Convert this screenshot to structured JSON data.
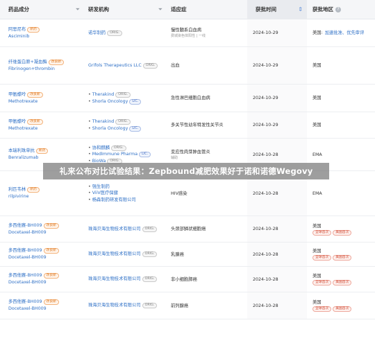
{
  "header": {
    "drug": "药品成分",
    "org": "研发机构",
    "indication": "适应症",
    "approval_date": "获批时间",
    "region": "获批地区",
    "region_help": "?"
  },
  "rows": [
    {
      "drug_cn": "阿思尼布",
      "drug_tag": "新药",
      "drug_tag_style": "t-o",
      "drug_en": "Asciminib",
      "orgs": [
        {
          "name": "诺华制药",
          "tag": "ORIG.",
          "tag_style": "t-g"
        }
      ],
      "indication": "慢性髓系白血病",
      "indication_sub": "费城染色体阳性 | 一线",
      "date": "2024-10-29",
      "region": "美国:",
      "region_extra": "加速批准、优先审评"
    },
    {
      "drug_cn": "纤维蛋白原+凝血酶",
      "drug_tag": "改良新",
      "drug_tag_style": "t-o",
      "drug_en": "Fibrinogen+thrombin",
      "orgs": [
        {
          "name": "Grifols Therapeutics LLC",
          "tag": "ORIG.",
          "tag_style": "t-g"
        }
      ],
      "indication": "出血",
      "date": "2024-10-29",
      "region": "美国"
    },
    {
      "drug_cn": "甲氨蝶呤",
      "drug_tag": "改良新",
      "drug_tag_style": "t-o",
      "drug_en": "Methotrexate",
      "orgs": [
        {
          "name": "Therakind",
          "tag": "ORIG.",
          "tag_style": "t-g"
        },
        {
          "name": "Shorla Oncology",
          "tag": "LIC.",
          "tag_style": "t-b"
        }
      ],
      "indication": "急性淋巴细胞白血病",
      "date": "2024-10-29",
      "region": "美国"
    },
    {
      "drug_cn": "甲氨蝶呤",
      "drug_tag": "改良新",
      "drug_tag_style": "t-o",
      "drug_en": "Methotrexate",
      "orgs": [
        {
          "name": "Therakind",
          "tag": "ORIG.",
          "tag_style": "t-g"
        },
        {
          "name": "Shorla Oncology",
          "tag": "LIC.",
          "tag_style": "t-b"
        }
      ],
      "indication": "多关节性幼年特发性关节炎",
      "date": "2024-10-29",
      "region": "美国"
    },
    {
      "drug_cn": "本瑞利珠单抗",
      "drug_tag": "新药",
      "drug_tag_style": "t-o",
      "drug_en": "Benralizumab",
      "orgs": [
        {
          "name": "协和麒麟",
          "tag": "ORIG.",
          "tag_style": "t-g"
        },
        {
          "name": "MedImmune Pharma",
          "tag": "LIC.",
          "tag_style": "t-b"
        },
        {
          "name": "BioWa",
          "tag": "ORIG.",
          "tag_style": "t-g"
        }
      ],
      "indication": "变应性肉芽肿血管炎",
      "indication_sub": "辅助",
      "date": "2024-10-28",
      "region": "EMA"
    },
    {
      "drug_cn": "利匹韦林",
      "drug_tag": "新药",
      "drug_tag_style": "t-o",
      "drug_en": "rilpivirine",
      "orgs": [
        {
          "name": "强生制药"
        },
        {
          "name": "ViiV医疗保健"
        },
        {
          "name": "杨森制药研发有限公司"
        }
      ],
      "indication": "HIV感染",
      "date": "2024-10-28",
      "region": "EMA"
    },
    {
      "drug_cn": "多西他赛-BH009",
      "drug_tag": "改良新",
      "drug_tag_style": "t-o",
      "drug_en": "Docetaxel-BH009",
      "orgs": [
        {
          "name": "珠海贝海生物技术有限公司",
          "tag": "ORIG.",
          "tag_style": "t-g"
        }
      ],
      "indication": "头颈部鳞状细胞癌",
      "date": "2024-10-28",
      "region": "美国",
      "region_tags": [
        "全球首次",
        "美国首次"
      ]
    },
    {
      "drug_cn": "多西他赛-BH009",
      "drug_tag": "改良新",
      "drug_tag_style": "t-o",
      "drug_en": "Docetaxel-BH009",
      "orgs": [
        {
          "name": "珠海贝海生物技术有限公司",
          "tag": "ORIG.",
          "tag_style": "t-g"
        }
      ],
      "indication": "乳腺癌",
      "date": "2024-10-28",
      "region": "美国",
      "region_tags": [
        "全球首次",
        "美国首次"
      ]
    },
    {
      "drug_cn": "多西他赛-BH009",
      "drug_tag": "改良新",
      "drug_tag_style": "t-o",
      "drug_en": "Docetaxel-BH009",
      "orgs": [
        {
          "name": "珠海贝海生物技术有限公司",
          "tag": "ORIG.",
          "tag_style": "t-g"
        }
      ],
      "indication": "非小细胞肺癌",
      "date": "2024-10-28",
      "region": "美国",
      "region_tags": [
        "全球首次",
        "美国首次"
      ]
    },
    {
      "drug_cn": "多西他赛-BH009",
      "drug_tag": "改良新",
      "drug_tag_style": "t-o",
      "drug_en": "Docetaxel-BH009",
      "orgs": [
        {
          "name": "珠海贝海生物技术有限公司",
          "tag": "ORIG.",
          "tag_style": "t-g"
        }
      ],
      "indication": "前列腺癌",
      "date": "2024-10-28",
      "region": "美国",
      "region_tags": [
        "全球首次",
        "美国首次"
      ]
    }
  ],
  "banner": "礼来公布对比试验结果：Zepbound减肥效果好于诺和诺德Wegovy",
  "icons": {
    "filter": "filter-icon",
    "sort": "sort-icon",
    "help": "help-icon"
  },
  "colors": {
    "link": "#2d6fc6",
    "header_bg": "#f5f6f8",
    "tag_orange": "#e0791f",
    "tag_red": "#d24b35"
  }
}
